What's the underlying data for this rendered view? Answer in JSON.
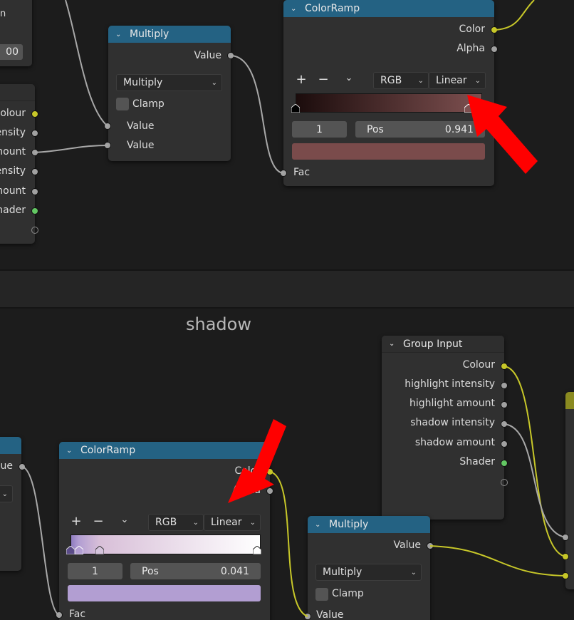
{
  "top": {
    "left_partial_node": {
      "field_value": "00",
      "text_frag": "n",
      "outputs": [
        "Colour",
        "ensity",
        "mount",
        "ensity",
        "mount",
        "hader"
      ]
    },
    "multiply_node": {
      "title": "Multiply",
      "output": "Value",
      "operation": "Multiply",
      "clamp_label": "Clamp",
      "inputs": [
        "Value",
        "Value"
      ]
    },
    "colorramp_node": {
      "title": "ColorRamp",
      "outputs": [
        "Color",
        "Alpha"
      ],
      "add_label": "+",
      "remove_label": "−",
      "mode": "RGB",
      "interpolation": "Linear",
      "stop_index": "1",
      "pos_label": "Pos",
      "pos_value": "0.941",
      "selected_color": "#7a4b4b",
      "gradient_start": "#1b0c0c",
      "gradient_end": "#7e5050",
      "input": "Fac"
    }
  },
  "bottom": {
    "frame_label": "shadow",
    "group_input_node": {
      "title": "Group Input",
      "outputs": [
        "Colour",
        "highlight intensity",
        "highlight amount",
        "shadow intensity",
        "shadow amount",
        "Shader"
      ]
    },
    "left_partial_node": {
      "output_frag": "lue"
    },
    "colorramp_node": {
      "title": "ColorRamp",
      "outputs": [
        "Color",
        "Alpha"
      ],
      "add_label": "+",
      "remove_label": "−",
      "mode": "RGB",
      "interpolation": "Linear",
      "stop_index": "1",
      "pos_label": "Pos",
      "pos_value": "0.041",
      "selected_color": "#b29ed2",
      "gradient_start": "#8f7cc0",
      "gradient_end": "#ffffff",
      "input": "Fac"
    },
    "multiply_node": {
      "title": "Multiply",
      "output": "Value",
      "operation": "Multiply",
      "clamp_label": "Clamp",
      "input": "Value"
    }
  },
  "colors": {
    "node_header": "#246283",
    "annotation_arrow": "#ff0000",
    "socket_float": "#a1a1a1",
    "socket_color": "#c7c729",
    "socket_shader": "#63c763"
  }
}
